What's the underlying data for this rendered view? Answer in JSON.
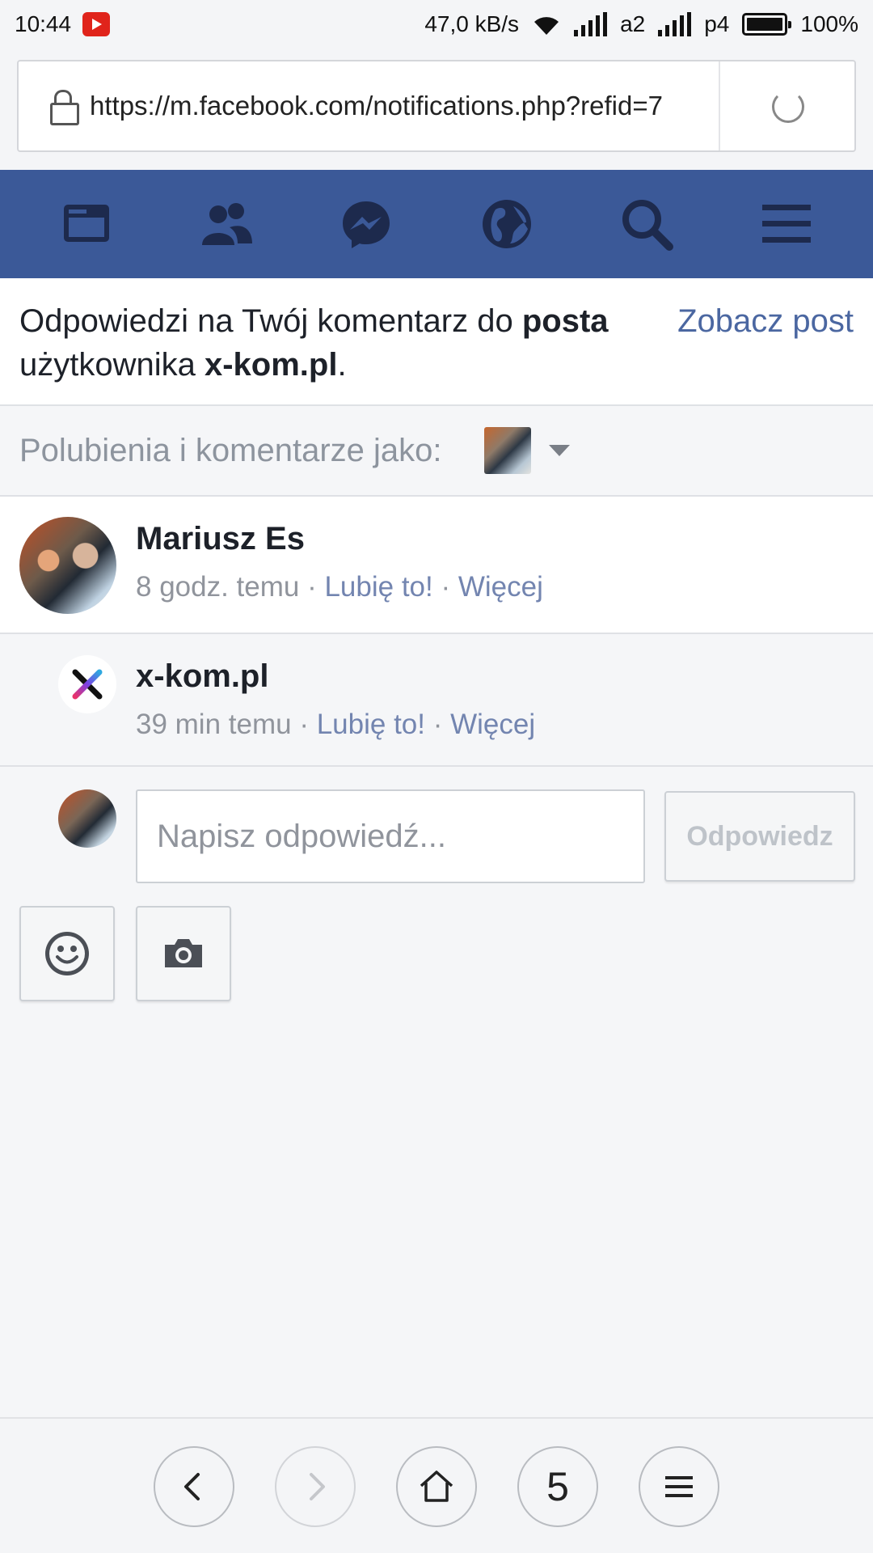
{
  "status_bar": {
    "time": "10:44",
    "speed": "47,0 kB/s",
    "sim1": "a2",
    "sim2": "p4",
    "battery": "100%"
  },
  "browser": {
    "url": "https://m.facebook.com/notifications.php?refid=7"
  },
  "fb_nav": {
    "icons": [
      "news-feed-icon",
      "friends-icon",
      "messenger-icon",
      "notifications-globe-icon",
      "search-icon",
      "menu-icon"
    ],
    "color": "#3b5998"
  },
  "notice": {
    "text_before": "Odpowiedzi na Twój komentarz do ",
    "text_bold_post": "posta",
    "text_middle": " użytkownika ",
    "text_bold_user": "x-kom.pl",
    "text_end": ".",
    "see_post": "Zobacz post"
  },
  "like_as": {
    "label": "Polubienia i komentarze jako:"
  },
  "comment": {
    "author": "Mariusz Es",
    "time": "8 godz. temu",
    "sep1": " · ",
    "like": "Lubię to!",
    "sep2": " · ",
    "more": "Więcej"
  },
  "reply": {
    "author": "x-kom.pl",
    "time": "39 min temu",
    "sep1": " · ",
    "like": "Lubię to!",
    "sep2": " · ",
    "more": "Więcej"
  },
  "compose": {
    "placeholder": "Napisz odpowiedź...",
    "value": "",
    "submit": "Odpowiedz",
    "tools": [
      "smiley-icon",
      "camera-icon"
    ]
  },
  "bottom_bar": {
    "tabs_count": "5"
  }
}
